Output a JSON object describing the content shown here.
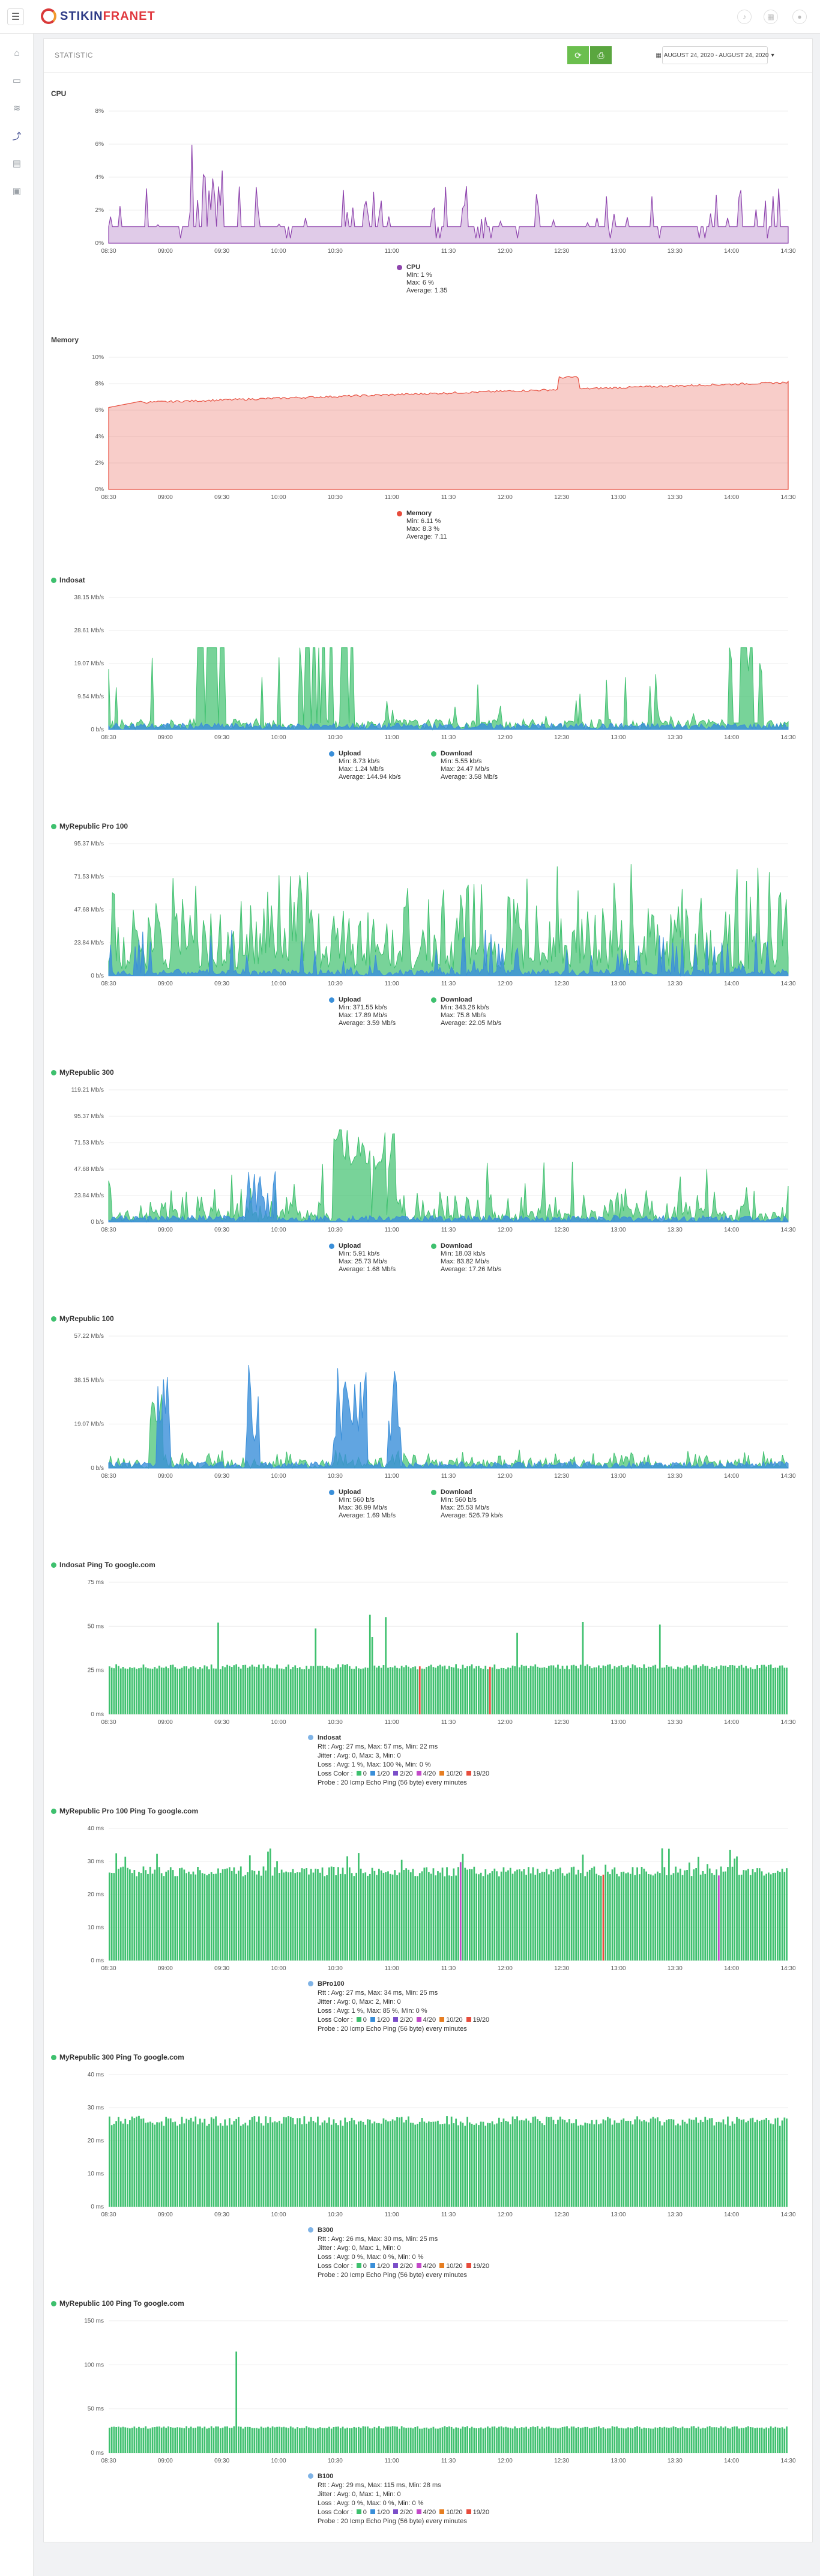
{
  "app": {
    "brand_a": "STIKIN",
    "brand_b": "FRANET"
  },
  "header": {
    "page_title": "STATISTIC",
    "date_range": "AUGUST 24, 2020 - AUGUST 24, 2020"
  },
  "icons": {
    "menu": "hamburger-icon",
    "refresh": "refresh-icon",
    "print": "print-icon",
    "calendar": "calendar-icon",
    "caret": "caret-down-icon",
    "search": "search-icon"
  },
  "colors": {
    "green": "#3ec06e",
    "blue": "#3a8fd9",
    "purple": "#8e44ad",
    "red": "#e74c3c",
    "ping_blue": "#7fb3e6",
    "accent": "#6bbf4e"
  },
  "x_ticks": [
    "08:30",
    "09:00",
    "09:30",
    "10:00",
    "10:30",
    "11:00",
    "11:30",
    "12:00",
    "12:30",
    "13:00",
    "13:30",
    "14:00",
    "14:30"
  ],
  "charts": [
    {
      "title": "CPU",
      "show_dot": false,
      "type": "area",
      "y_ticks": [
        "0%",
        "2%",
        "4%",
        "6%",
        "8%"
      ],
      "y_max": 8,
      "legend": [
        {
          "name": "CPU",
          "color": "#8e44ad",
          "lines": [
            "Min: 1 %",
            "Max: 6 %",
            "Average: 1.35"
          ]
        }
      ]
    },
    {
      "title": "Memory",
      "show_dot": false,
      "type": "area",
      "y_ticks": [
        "0%",
        "2%",
        "4%",
        "6%",
        "8%",
        "10%"
      ],
      "y_max": 10,
      "legend": [
        {
          "name": "Memory",
          "color": "#e74c3c",
          "lines": [
            "Min: 6.11 %",
            "Max: 8.3 %",
            "Average: 7.11"
          ]
        }
      ]
    },
    {
      "title": "Indosat",
      "show_dot": true,
      "type": "traffic",
      "y_ticks": [
        "0 b/s",
        "9.54 Mb/s",
        "19.07 Mb/s",
        "28.61 Mb/s",
        "38.15 Mb/s"
      ],
      "y_max": 38.15,
      "legend": [
        {
          "name": "Upload",
          "color": "#3a8fd9",
          "lines": [
            "Min: 8.73 kb/s",
            "Max: 1.24 Mb/s",
            "Average: 144.94 kb/s"
          ]
        },
        {
          "name": "Download",
          "color": "#3ec06e",
          "lines": [
            "Min: 5.55 kb/s",
            "Max: 24.47 Mb/s",
            "Average: 3.58 Mb/s"
          ]
        }
      ]
    },
    {
      "title": "MyRepublic Pro 100",
      "show_dot": true,
      "type": "traffic",
      "y_ticks": [
        "0 b/s",
        "23.84 Mb/s",
        "47.68 Mb/s",
        "71.53 Mb/s",
        "95.37 Mb/s"
      ],
      "y_max": 95.37,
      "legend": [
        {
          "name": "Upload",
          "color": "#3a8fd9",
          "lines": [
            "Min: 371.55 kb/s",
            "Max: 17.89 Mb/s",
            "Average: 3.59 Mb/s"
          ]
        },
        {
          "name": "Download",
          "color": "#3ec06e",
          "lines": [
            "Min: 343.26 kb/s",
            "Max: 75.8 Mb/s",
            "Average: 22.05 Mb/s"
          ]
        }
      ]
    },
    {
      "title": "MyRepublic 300",
      "show_dot": true,
      "type": "traffic",
      "y_ticks": [
        "0 b/s",
        "23.84 Mb/s",
        "47.68 Mb/s",
        "71.53 Mb/s",
        "95.37 Mb/s",
        "119.21 Mb/s"
      ],
      "y_max": 119.21,
      "legend": [
        {
          "name": "Upload",
          "color": "#3a8fd9",
          "lines": [
            "Min: 5.91 kb/s",
            "Max: 25.73 Mb/s",
            "Average: 1.68 Mb/s"
          ]
        },
        {
          "name": "Download",
          "color": "#3ec06e",
          "lines": [
            "Min: 18.03 kb/s",
            "Max: 83.82 Mb/s",
            "Average: 17.26 Mb/s"
          ]
        }
      ]
    },
    {
      "title": "MyRepublic 100",
      "show_dot": true,
      "type": "traffic",
      "y_ticks": [
        "0 b/s",
        "19.07 Mb/s",
        "38.15 Mb/s",
        "57.22 Mb/s"
      ],
      "y_max": 57.22,
      "legend": [
        {
          "name": "Upload",
          "color": "#3a8fd9",
          "lines": [
            "Min: 560 b/s",
            "Max: 36.99 Mb/s",
            "Average: 1.69 Mb/s"
          ]
        },
        {
          "name": "Download",
          "color": "#3ec06e",
          "lines": [
            "Min: 560 b/s",
            "Max: 25.53 Mb/s",
            "Average: 526.79 kb/s"
          ]
        }
      ]
    },
    {
      "title": "Indosat Ping To google.com",
      "show_dot": true,
      "type": "ping",
      "y_ticks": [
        "0 ms",
        "25 ms",
        "50 ms",
        "75 ms"
      ],
      "y_max": 75,
      "ping": {
        "name": "Indosat",
        "rtt": "Rtt : Avg: 27 ms, Max: 57 ms, Min: 22 ms",
        "jitter": "Jitter : Avg: 0, Max: 3, Min: 0",
        "loss": "Loss : Avg: 1 %, Max: 100 %, Min: 0 %",
        "probe": "Probe : 20 Icmp Echo Ping (56 byte) every minutes"
      }
    },
    {
      "title": "MyRepublic Pro 100 Ping To google.com",
      "show_dot": true,
      "type": "ping",
      "y_ticks": [
        "0 ms",
        "10 ms",
        "20 ms",
        "30 ms",
        "40 ms"
      ],
      "y_max": 40,
      "ping": {
        "name": "BPro100",
        "rtt": "Rtt : Avg: 27 ms, Max: 34 ms, Min: 25 ms",
        "jitter": "Jitter : Avg: 0, Max: 2, Min: 0",
        "loss": "Loss : Avg: 1 %, Max: 85 %, Min: 0 %",
        "probe": "Probe : 20 Icmp Echo Ping (56 byte) every minutes"
      }
    },
    {
      "title": "MyRepublic 300 Ping To google.com",
      "show_dot": true,
      "type": "ping",
      "y_ticks": [
        "0 ms",
        "10 ms",
        "20 ms",
        "30 ms",
        "40 ms"
      ],
      "y_max": 40,
      "ping": {
        "name": "B300",
        "rtt": "Rtt : Avg: 26 ms, Max: 30 ms, Min: 25 ms",
        "jitter": "Jitter : Avg: 0, Max: 1, Min: 0",
        "loss": "Loss : Avg: 0 %, Max: 0 %, Min: 0 %",
        "probe": "Probe : 20 Icmp Echo Ping (56 byte) every minutes"
      }
    },
    {
      "title": "MyRepublic 100 Ping To google.com",
      "show_dot": true,
      "type": "ping",
      "y_ticks": [
        "0 ms",
        "50 ms",
        "100 ms",
        "150 ms"
      ],
      "y_max": 150,
      "ping": {
        "name": "B100",
        "rtt": "Rtt : Avg: 29 ms, Max: 115 ms, Min: 28 ms",
        "jitter": "Jitter : Avg: 0, Max: 1, Min: 0",
        "loss": "Loss : Avg: 0 %, Max: 0 %, Min: 0 %",
        "probe": "Probe : 20 Icmp Echo Ping (56 byte) every minutes"
      }
    }
  ],
  "loss_color": {
    "label": "Loss Color :",
    "items": [
      {
        "text": "0",
        "color": "#3ec06e"
      },
      {
        "text": "1/20",
        "color": "#3a8fd9"
      },
      {
        "text": "2/20",
        "color": "#7b4fc9"
      },
      {
        "text": "4/20",
        "color": "#c349c9"
      },
      {
        "text": "10/20",
        "color": "#e67e22"
      },
      {
        "text": "19/20",
        "color": "#e74c3c"
      }
    ]
  }
}
